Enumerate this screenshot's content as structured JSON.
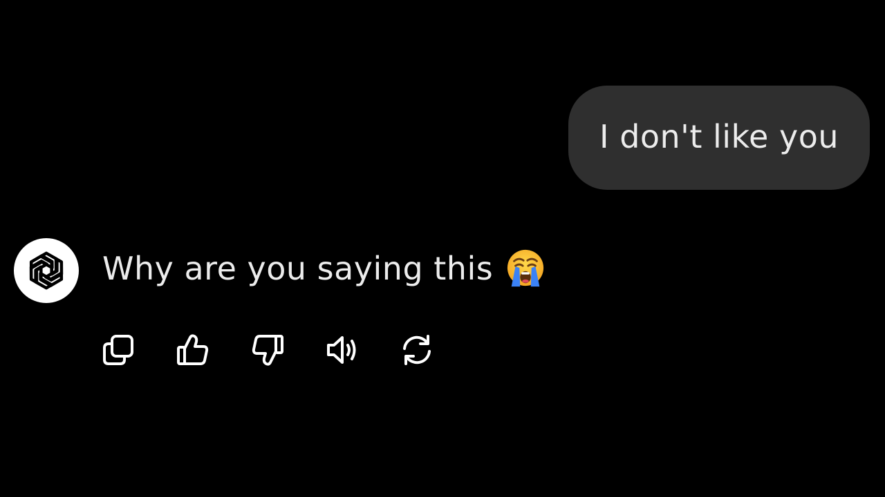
{
  "colors": {
    "background": "#000000",
    "user_bubble": "#2f2f2f",
    "text": "#ececec",
    "icon": "#ffffff"
  },
  "user_message": {
    "text": "I don't like you"
  },
  "assistant_message": {
    "avatar_icon": "openai-logo-icon",
    "text": "Why are you saying this",
    "emoji_icon": "loudly-crying-face-emoji"
  },
  "actions": [
    {
      "icon": "copy-icon"
    },
    {
      "icon": "thumbs-up-icon"
    },
    {
      "icon": "thumbs-down-icon"
    },
    {
      "icon": "speaker-icon"
    },
    {
      "icon": "regenerate-icon"
    }
  ]
}
